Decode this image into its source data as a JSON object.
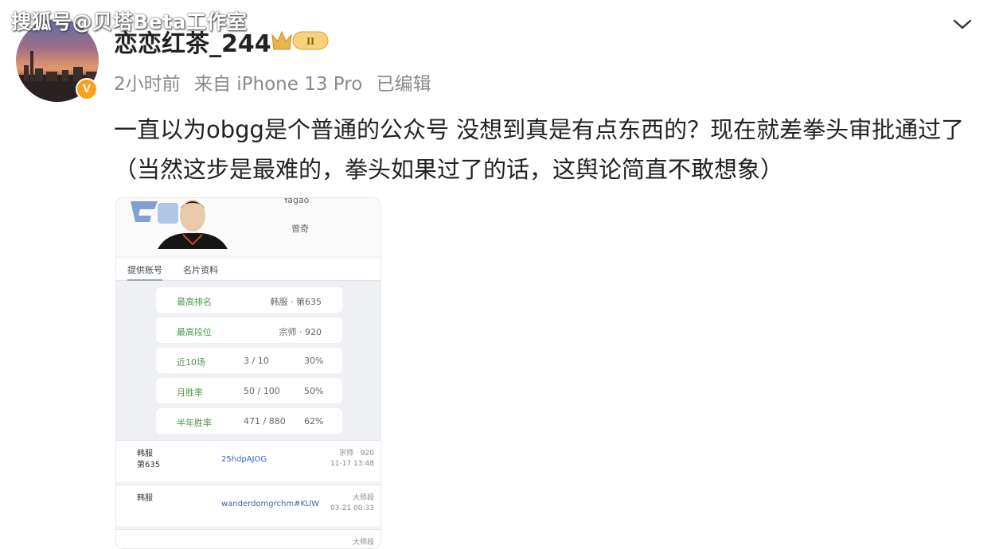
{
  "watermark": "搜狐号@贝塔Beta工作室",
  "post": {
    "username": "恋恋红茶_244",
    "level_badge": "II",
    "verified_badge": "V",
    "time": "2小时前",
    "source": "来自 iPhone 13 Pro",
    "edited": "已编辑",
    "text": "一直以为obgg是个普通的公众号 没想到真是有点东西的？现在就差拳头审批通过了（当然这步是最难的，拳头如果过了的话，这舆论简直不敢想象）"
  },
  "card": {
    "player_name": "Yagao",
    "player_sub": "曾奇",
    "tabs": [
      "提供账号",
      "名片资料"
    ],
    "stats": [
      {
        "label": "最高排名",
        "value": "韩服 · 第635",
        "pct": ""
      },
      {
        "label": "最高段位",
        "value": "宗师 · 920",
        "pct": ""
      },
      {
        "label": "近10场",
        "value": "3 / 10",
        "pct": "30%"
      },
      {
        "label": "月胜率",
        "value": "50 / 100",
        "pct": "50%"
      },
      {
        "label": "半年胜率",
        "value": "471 / 880",
        "pct": "62%"
      }
    ],
    "rows": [
      {
        "a1": "韩服",
        "a2": "第635",
        "b": "25hdpAJOG",
        "c1": "宗师 · 920",
        "c2": "11-17 13:48"
      },
      {
        "a1": "韩服",
        "a2": "",
        "b": "wanderdomgrchm#KUW",
        "c1": "大师段",
        "c2": "03-21 00:33"
      },
      {
        "a1": "",
        "a2": "",
        "b": "",
        "c1": "大师段",
        "c2": ""
      }
    ]
  },
  "colors": {
    "username": "#222222",
    "meta": "#8a8a8a",
    "verified": "#f7a21f",
    "link": "#3a66b8"
  },
  "icons": [
    "crown-level-icon",
    "chevron-down-icon",
    "verified-v-icon"
  ]
}
